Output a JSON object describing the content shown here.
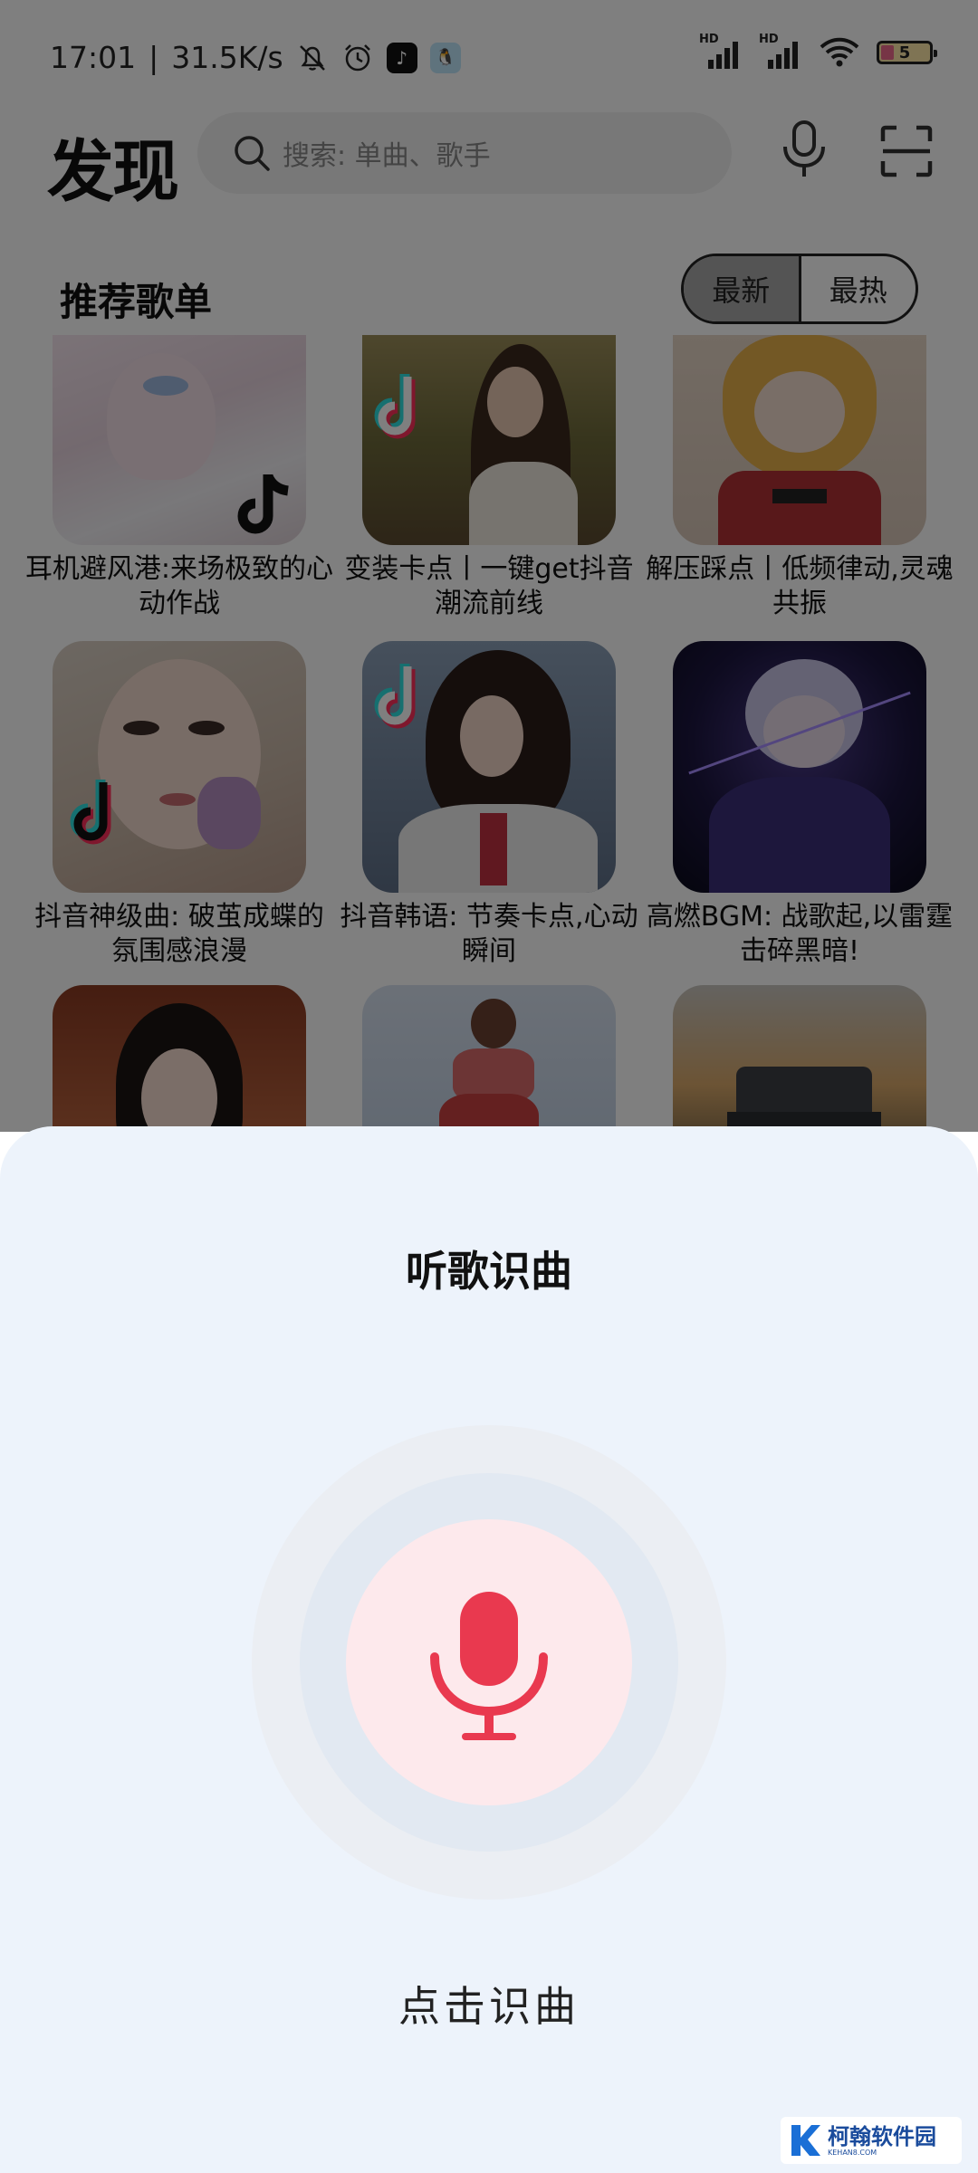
{
  "status_bar": {
    "time": "17:01",
    "speed": "31.5K/s",
    "battery": "5",
    "signal_label": "HD"
  },
  "header": {
    "title": "发现",
    "search_placeholder": "搜索: 单曲、歌手"
  },
  "section": {
    "title": "推荐歌单",
    "tabs": [
      "最新",
      "最热"
    ],
    "selected_tab": "最新"
  },
  "playlists": [
    {
      "title": "耳机避风港:来场极致的心动作战"
    },
    {
      "title": "变装卡点丨一键get抖音潮流前线"
    },
    {
      "title": "解压踩点丨低频律动,灵魂共振"
    },
    {
      "title": "抖音神级曲: 破茧成蝶的氛围感浪漫"
    },
    {
      "title": "抖音韩语: 节奏卡点,心动瞬间"
    },
    {
      "title": "高燃BGM: 战歌起,以雷霆击碎黑暗!"
    }
  ],
  "recognize_sheet": {
    "title": "听歌识曲",
    "action_label": "点击识曲",
    "accent_color": "#e9394f"
  },
  "watermark": {
    "name": "柯翰软件园",
    "domain": "KEHAN8.COM"
  }
}
